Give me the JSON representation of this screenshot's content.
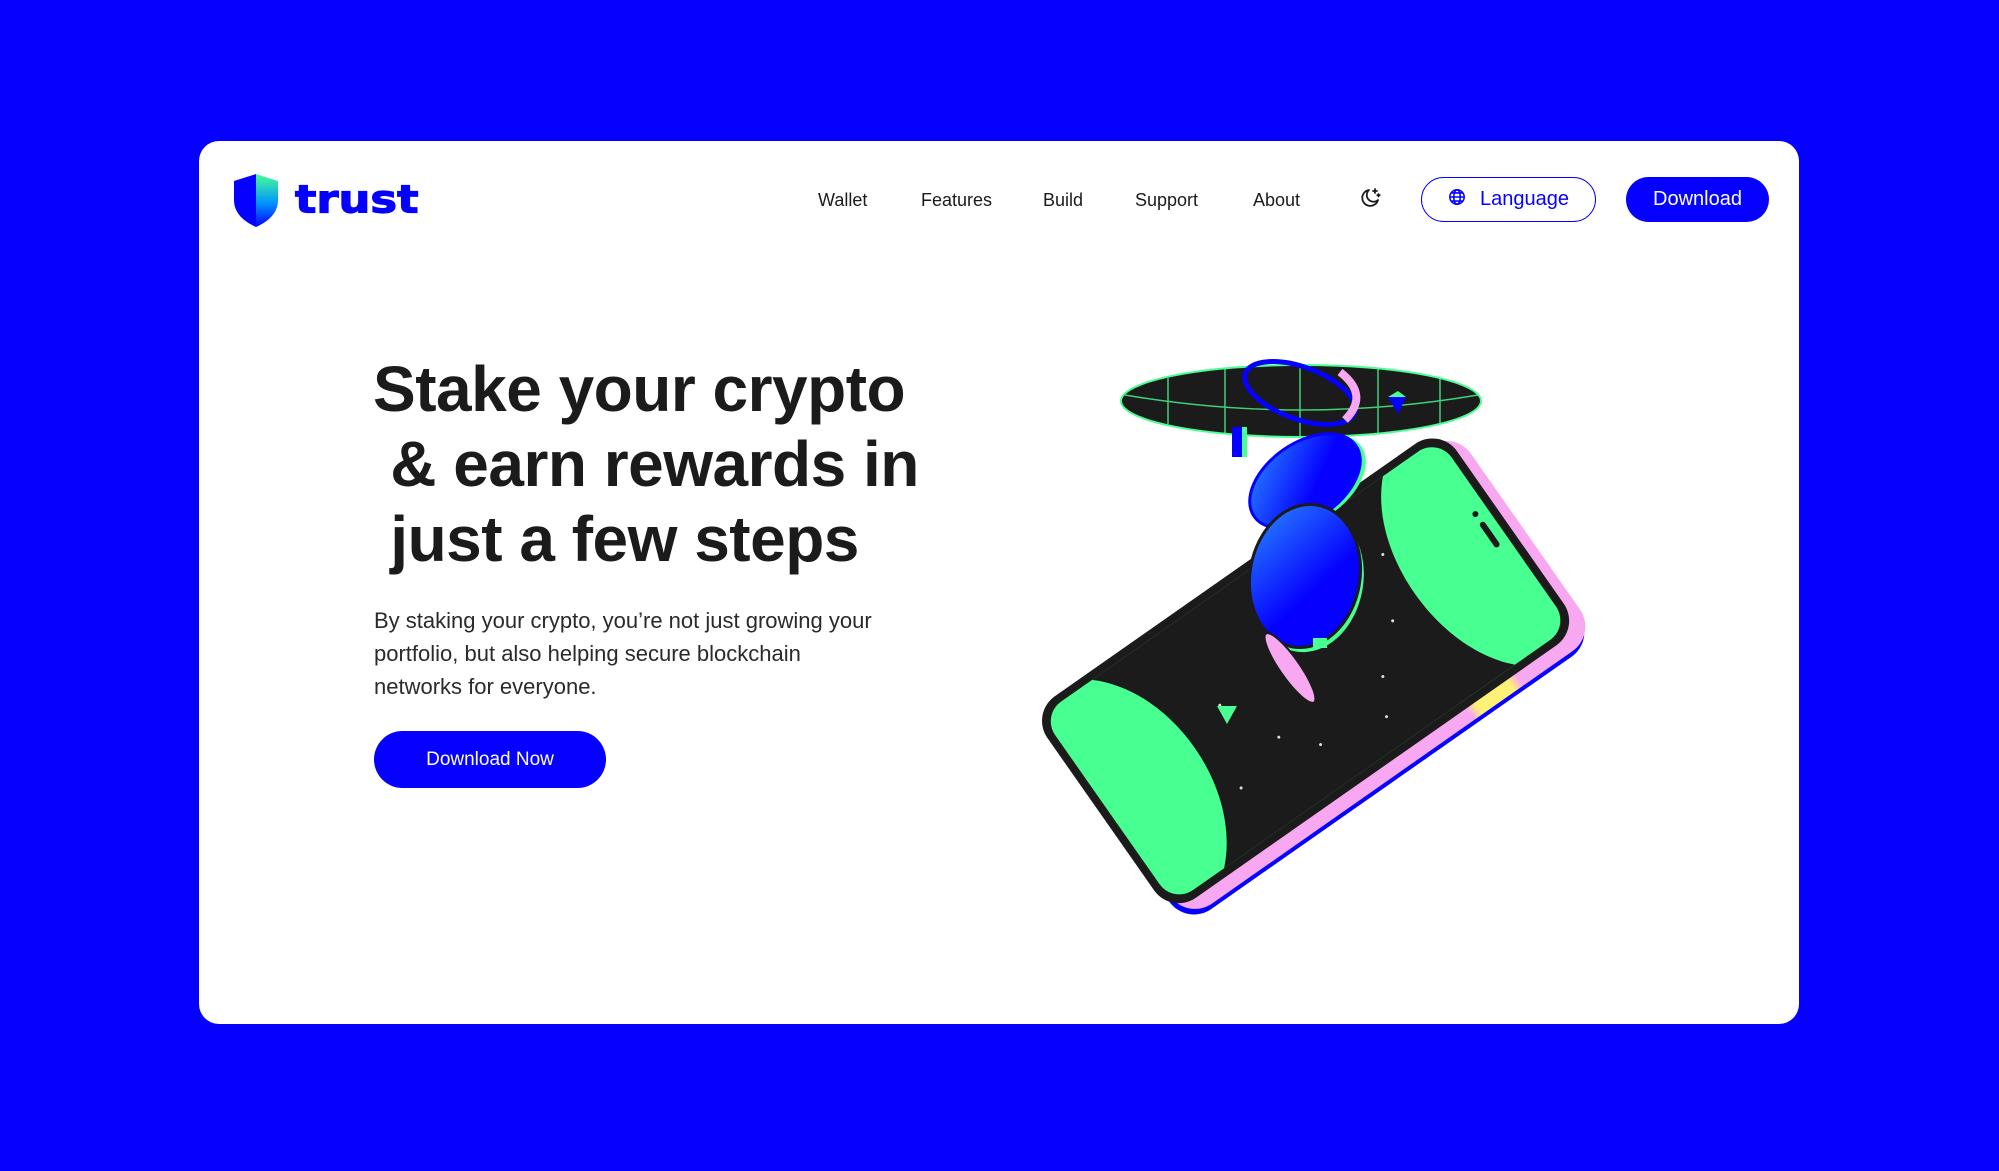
{
  "colors": {
    "background": "#0500ff",
    "card": "#ffffff",
    "brand": "#0500ff",
    "text": "#1b1b1b",
    "illustration_green": "#48ff91",
    "illustration_dark": "#1b1b1b",
    "illustration_pink": "#f8a8f0",
    "illustration_yellow": "#fff176"
  },
  "header": {
    "logo": {
      "icon": "shield-icon",
      "wordmark": "trust"
    },
    "nav": [
      {
        "label": "Wallet"
      },
      {
        "label": "Features"
      },
      {
        "label": "Build"
      },
      {
        "label": "Support"
      },
      {
        "label": "About"
      }
    ],
    "theme_toggle_icon": "moon-stars-icon",
    "language_button": {
      "icon": "globe-icon",
      "label": "Language"
    },
    "download_button": {
      "label": "Download"
    }
  },
  "hero": {
    "title_lines": [
      "Stake your crypto",
      " & earn rewards in",
      " just a few steps"
    ],
    "description_lines": [
      "By staking your crypto, you’re not just growing your",
      "portfolio, but also helping secure blockchain",
      "networks for everyone."
    ],
    "cta_label": "Download Now",
    "illustration": "phone-with-floating-coins-illustration"
  }
}
